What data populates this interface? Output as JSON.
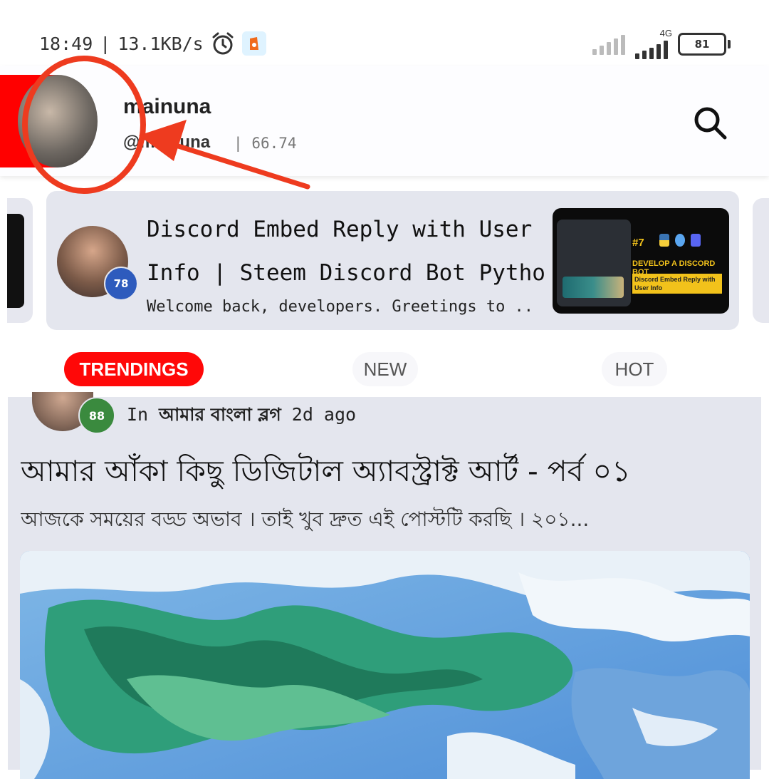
{
  "status_bar": {
    "time": "18:49",
    "separator": "|",
    "net_speed": "13.1KB/s",
    "network_type": "4G",
    "battery": "81",
    "battery_level_percent": 81
  },
  "header": {
    "user_name": "mainuna",
    "user_handle": "@mainuna",
    "separator": "|",
    "user_rep": "66.74"
  },
  "featured": {
    "author_rep": "78",
    "title_line1": "Discord Embed Reply with User",
    "title_line2": "Info | Steem Discord Bot Pytho...",
    "snippet": "Welcome back, developers. Greetings to ...",
    "thumbnail": {
      "number": "#7",
      "headline": "DEVELOP A DISCORD BOT",
      "tag": "Discord Embed Reply with User Info"
    }
  },
  "tabs": [
    {
      "label": "TRENDINGS",
      "active": true
    },
    {
      "label": "NEW",
      "active": false
    },
    {
      "label": "HOT",
      "active": false
    }
  ],
  "post": {
    "author_rep": "88",
    "prefix": "In",
    "community": "আমার বাংলা ব্লগ",
    "age": "2d ago",
    "title": "আমার আঁকা কিছু ডিজিটাল অ্যাবস্ট্রাক্ট আর্ট - পর্ব ০১",
    "excerpt": "আজকে সময়ের বড্ড অভাব । তাই খুব দ্রুত এই পোস্টটি করছি । ২০১..."
  },
  "colors": {
    "accent_red": "#ff0808",
    "annotation_red": "#ee3b1f",
    "card_bg": "#e4e6ee",
    "rep_blue": "#2e5bbd",
    "rep_green": "#3a8a3e"
  },
  "icons": {
    "alarm": "alarm-clock-icon",
    "app": "app-notification-icon",
    "search": "search-icon"
  }
}
